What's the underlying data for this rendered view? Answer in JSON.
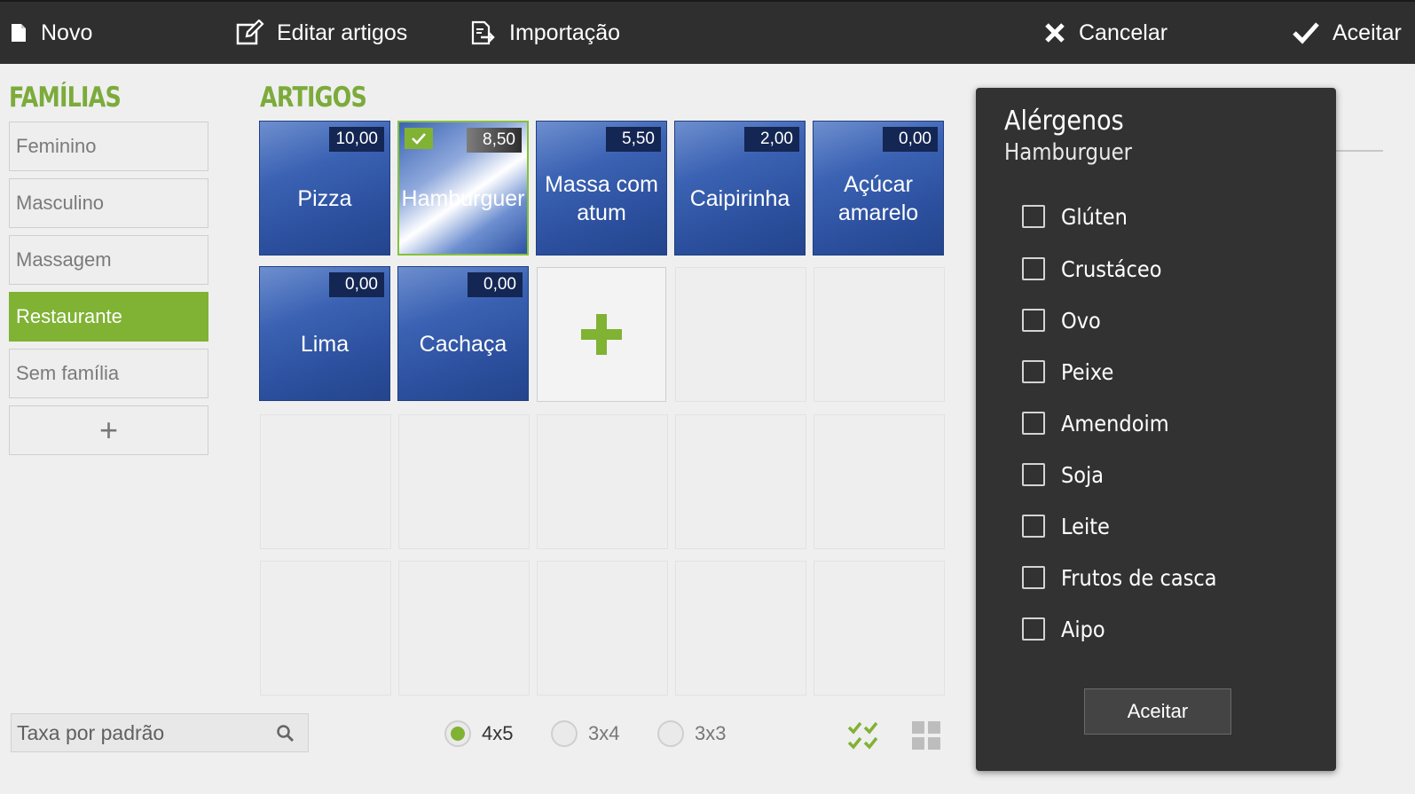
{
  "toolbar": {
    "novo": "Novo",
    "editar_artigos": "Editar artigos",
    "importacao": "Importação",
    "cancelar": "Cancelar",
    "aceitar": "Aceitar"
  },
  "families": {
    "title": "FAMÍLIAS",
    "items": [
      {
        "label": "Feminino"
      },
      {
        "label": "Masculino"
      },
      {
        "label": "Massagem"
      },
      {
        "label": "Restaurante"
      },
      {
        "label": "Sem família"
      }
    ],
    "active": "Restaurante",
    "add_label": "+"
  },
  "articles": {
    "title": "ARTIGOS",
    "items": [
      {
        "name": "Pizza",
        "price": "10,00"
      },
      {
        "name": "Hamburguer",
        "price": "8,50"
      },
      {
        "name": "Massa com atum",
        "price": "5,50"
      },
      {
        "name": "Caipirinha",
        "price": "2,00"
      },
      {
        "name": "Açúcar amarelo",
        "price": "0,00"
      },
      {
        "name": "Lima",
        "price": "0,00"
      },
      {
        "name": "Cachaça",
        "price": "0,00"
      }
    ],
    "selected": "Hamburguer"
  },
  "bottom": {
    "tax_placeholder": "Taxa por padrão",
    "grid_options": [
      {
        "label": "4x5"
      },
      {
        "label": "3x4"
      },
      {
        "label": "3x3"
      }
    ],
    "grid_selected": "4x5"
  },
  "dialog": {
    "title": "Alérgenos",
    "subtitle": "Hamburguer",
    "allergens": [
      {
        "label": "Glúten"
      },
      {
        "label": "Crustáceo"
      },
      {
        "label": "Ovo"
      },
      {
        "label": "Peixe"
      },
      {
        "label": "Amendoim"
      },
      {
        "label": "Soja"
      },
      {
        "label": "Leite"
      },
      {
        "label": "Frutos de casca"
      },
      {
        "label": "Aipo"
      }
    ],
    "accept_label": "Aceitar"
  },
  "colors": {
    "accent_green": "#80b234",
    "article_blue": "#2c509e",
    "toolbar_bg": "#2f2f2f",
    "dialog_bg": "#323232"
  },
  "icons": {
    "novo": "document-icon",
    "editar": "edit-icon",
    "importacao": "import-icon",
    "cancelar": "close-icon",
    "aceitar": "check-icon",
    "search": "search-icon",
    "select_all": "check-grid-icon",
    "grid_view": "grid-icon"
  }
}
